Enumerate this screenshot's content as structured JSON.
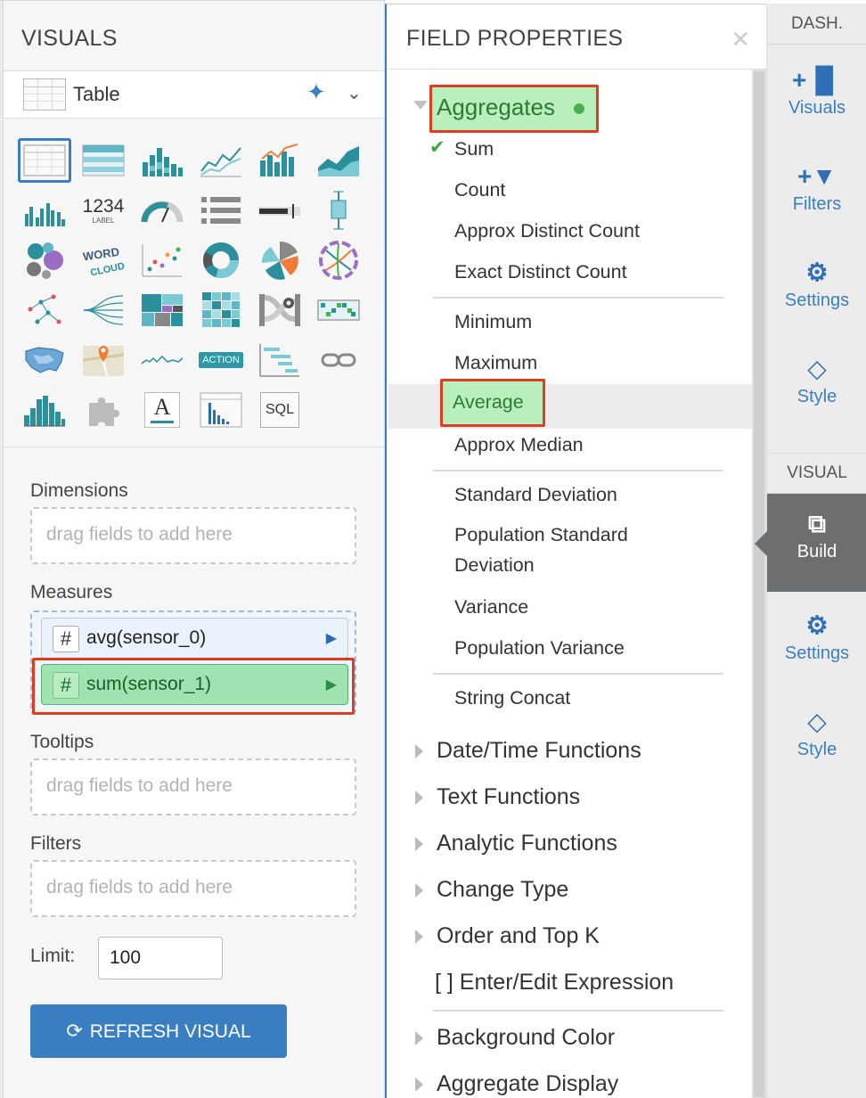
{
  "visuals_panel": {
    "title": "VISUALS",
    "visual_type": "Table",
    "icon_labels": {
      "kpi": "1234",
      "kpi_sub": "LABEL",
      "word_cloud": "WORD CLOUD",
      "action": "ACTION",
      "rich_text": "A",
      "sql": "SQL"
    },
    "shelves": {
      "dimensions": {
        "label": "Dimensions",
        "placeholder": "drag fields to add here"
      },
      "measures": {
        "label": "Measures",
        "items": [
          {
            "badge": "#",
            "name": "avg(sensor_0)"
          },
          {
            "badge": "#",
            "name": "sum(sensor_1)"
          }
        ]
      },
      "tooltips": {
        "label": "Tooltips",
        "placeholder": "drag fields to add here"
      },
      "filters": {
        "label": "Filters",
        "placeholder": "drag fields to add here"
      }
    },
    "limit": {
      "label": "Limit:",
      "value": "100"
    },
    "refresh_button": "REFRESH VISUAL"
  },
  "field_properties": {
    "title": "FIELD PROPERTIES",
    "aggregates": {
      "label": "Aggregates",
      "groups": [
        [
          {
            "label": "Sum",
            "checked": true
          },
          {
            "label": "Count"
          },
          {
            "label": "Approx Distinct Count"
          },
          {
            "label": "Exact Distinct Count"
          }
        ],
        [
          {
            "label": "Minimum"
          },
          {
            "label": "Maximum"
          },
          {
            "label": "Average"
          },
          {
            "label": "Approx Median"
          }
        ],
        [
          {
            "label": "Standard Deviation"
          },
          {
            "label": "Population Standard Deviation"
          },
          {
            "label": "Variance"
          },
          {
            "label": "Population Variance"
          }
        ],
        [
          {
            "label": "String Concat"
          }
        ]
      ]
    },
    "categories": [
      "Date/Time Functions",
      "Text Functions",
      "Analytic Functions",
      "Change Type",
      "Order and Top K",
      "[ ] Enter/Edit Expression",
      "Background Color",
      "Aggregate Display"
    ]
  },
  "right_rail": {
    "dash_header": "DASH.",
    "dash_items": [
      "Visuals",
      "Filters",
      "Settings",
      "Style"
    ],
    "visual_header": "VISUAL",
    "visual_items": [
      "Build",
      "Settings",
      "Style"
    ]
  },
  "colors": {
    "accent": "#3a7ec2",
    "highlight_green": "#b9eebd",
    "annotation_red": "#e03c1f",
    "rail_active": "#6d6e70"
  }
}
